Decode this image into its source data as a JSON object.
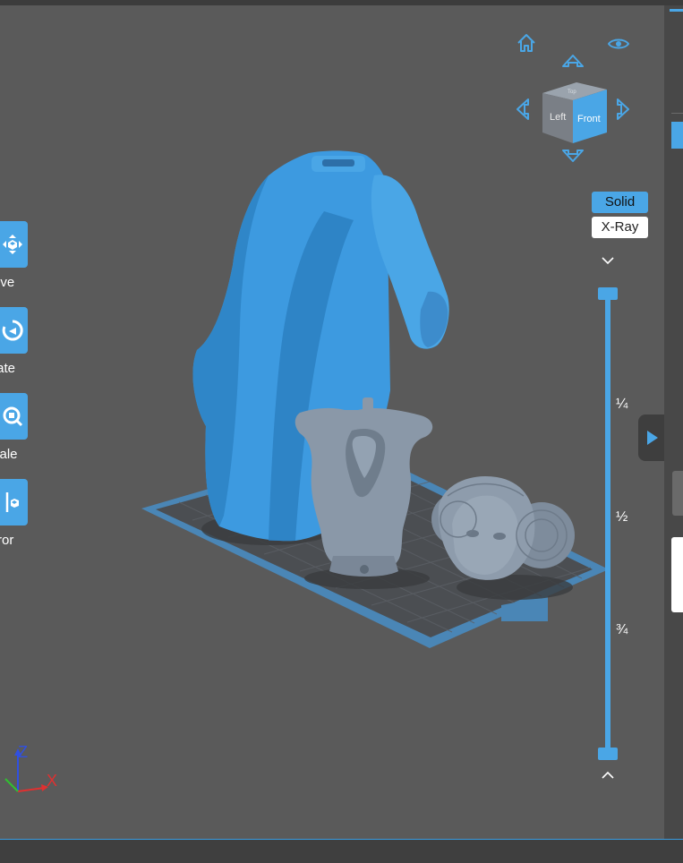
{
  "toolbar": {
    "tools": [
      {
        "id": "move",
        "label": "ove",
        "icon": "move-icon"
      },
      {
        "id": "rotate",
        "label": "tate",
        "icon": "rotate-icon"
      },
      {
        "id": "scale",
        "label": "cale",
        "icon": "scale-icon"
      },
      {
        "id": "mirror",
        "label": "rror",
        "icon": "mirror-icon"
      }
    ]
  },
  "view_cube": {
    "left_face": "Left",
    "front_face": "Front",
    "top_face": "Top"
  },
  "render_mode": {
    "solid_label": "Solid",
    "xray_label": "X-Ray",
    "selected": "Solid"
  },
  "layer_slider": {
    "ticks": [
      "¼",
      "½",
      "¾"
    ]
  },
  "axes": {
    "x": "X",
    "z": "Z"
  },
  "colors": {
    "accent": "#4aa6e6",
    "model_blue": "#3d9ae0",
    "model_grey": "#8696a6",
    "axis_x": "#e03030",
    "axis_y": "#30c030",
    "axis_z": "#3050e0"
  }
}
